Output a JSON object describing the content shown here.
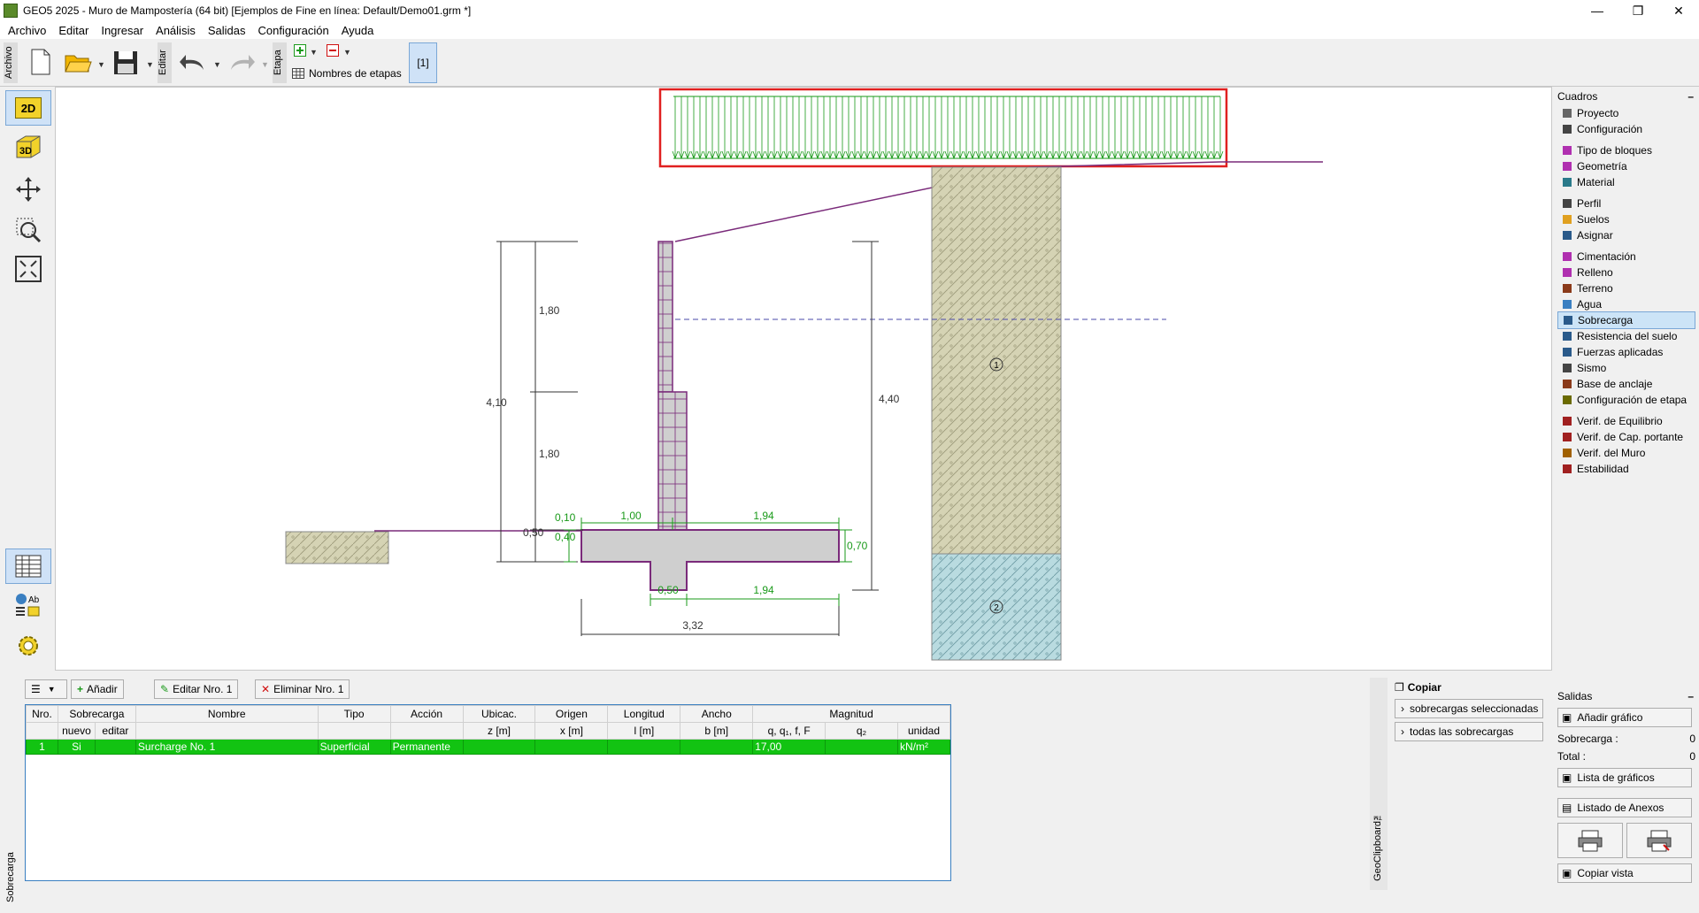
{
  "window": {
    "title": "GEO5 2025 - Muro de Mampostería (64 bit) [Ejemplos de Fine en línea: Default/Demo01.grm *]"
  },
  "menu": [
    "Archivo",
    "Editar",
    "Ingresar",
    "Análisis",
    "Salidas",
    "Configuración",
    "Ayuda"
  ],
  "toolbar": {
    "archivo_label": "Archivo",
    "editar_label": "Editar",
    "etapa_label": "Etapa",
    "stage_names_label": "Nombres de etapas",
    "stage_button": "[1]"
  },
  "lefttools": {
    "view_2d": "2D",
    "view_3d": "3D"
  },
  "drawing": {
    "dims": {
      "h1": "1,80",
      "h2": "1,80",
      "total_left": "4,10",
      "total_right": "4,40",
      "d010": "0,10",
      "d040": "0,40",
      "d050_left": "0,50",
      "d070": "0,70",
      "top_100": "1,00",
      "top_194": "1,94",
      "bot_050": "0,50",
      "bot_194": "1,94",
      "total_332": "3,32"
    },
    "soil_labels": [
      "1",
      "2"
    ]
  },
  "rightpanel": {
    "header": "Cuadros",
    "items": [
      {
        "label": "Proyecto",
        "icon": "document-icon"
      },
      {
        "label": "Configuración",
        "icon": "gear-icon"
      },
      {
        "label": "Tipo de bloques",
        "icon": "block-type-icon"
      },
      {
        "label": "Geometría",
        "icon": "geometry-icon"
      },
      {
        "label": "Material",
        "icon": "material-icon"
      },
      {
        "label": "Perfil",
        "icon": "profile-icon"
      },
      {
        "label": "Suelos",
        "icon": "soils-icon"
      },
      {
        "label": "Asignar",
        "icon": "assign-icon"
      },
      {
        "label": "Cimentación",
        "icon": "foundation-icon"
      },
      {
        "label": "Relleno",
        "icon": "backfill-icon"
      },
      {
        "label": "Terreno",
        "icon": "terrain-icon"
      },
      {
        "label": "Agua",
        "icon": "water-icon"
      },
      {
        "label": "Sobrecarga",
        "icon": "surcharge-icon"
      },
      {
        "label": "Resistencia del suelo",
        "icon": "resistance-icon"
      },
      {
        "label": "Fuerzas aplicadas",
        "icon": "forces-icon"
      },
      {
        "label": "Sismo",
        "icon": "earthquake-icon"
      },
      {
        "label": "Base de anclaje",
        "icon": "anchor-icon"
      },
      {
        "label": "Configuración de etapa",
        "icon": "stage-settings-icon"
      },
      {
        "label": "Verif. de Equilibrio",
        "icon": "equilibrium-icon"
      },
      {
        "label": "Verif. de Cap. portante",
        "icon": "bearing-icon"
      },
      {
        "label": "Verif. del Muro",
        "icon": "wall-check-icon"
      },
      {
        "label": "Estabilidad",
        "icon": "stability-icon"
      }
    ]
  },
  "bottom": {
    "side_label": "Sobrecarga",
    "buttons": {
      "add": "Añadir",
      "edit": "Editar Nro. 1",
      "delete": "Eliminar Nro. 1"
    },
    "headers1": [
      "Nro.",
      "Sobrecarga",
      "Nombre",
      "Tipo",
      "Acción",
      "Ubicac.",
      "Origen",
      "Longitud",
      "Ancho",
      "Magnitud"
    ],
    "headers2": [
      "",
      "nuevo",
      "editar",
      "",
      "",
      "",
      "z [m]",
      "x [m]",
      "l [m]",
      "b [m]",
      "q, q₁, f, F",
      "q₂",
      "unidad"
    ],
    "rows": [
      {
        "nro": "1",
        "nuevo": "Si",
        "editar": "",
        "nombre": "Surcharge No. 1",
        "tipo": "Superficial",
        "accion": "Permanente",
        "z": "",
        "x": "",
        "l": "",
        "b": "",
        "q1": "17,00",
        "q2": "",
        "unidad": "kN/m²"
      }
    ]
  },
  "clipboard": {
    "side_label": "GeoClipboard™",
    "title": "Copiar",
    "selected": "sobrecargas seleccionadas",
    "all": "todas las sobrecargas"
  },
  "salidas": {
    "header": "Salidas",
    "add_graphic": "Añadir gráfico",
    "surcharge_label": "Sobrecarga :",
    "surcharge_value": "0",
    "total_label": "Total :",
    "total_value": "0",
    "graphics_list": "Lista de gráficos",
    "annex_list": "Listado de Anexos",
    "copy_view": "Copiar vista"
  }
}
